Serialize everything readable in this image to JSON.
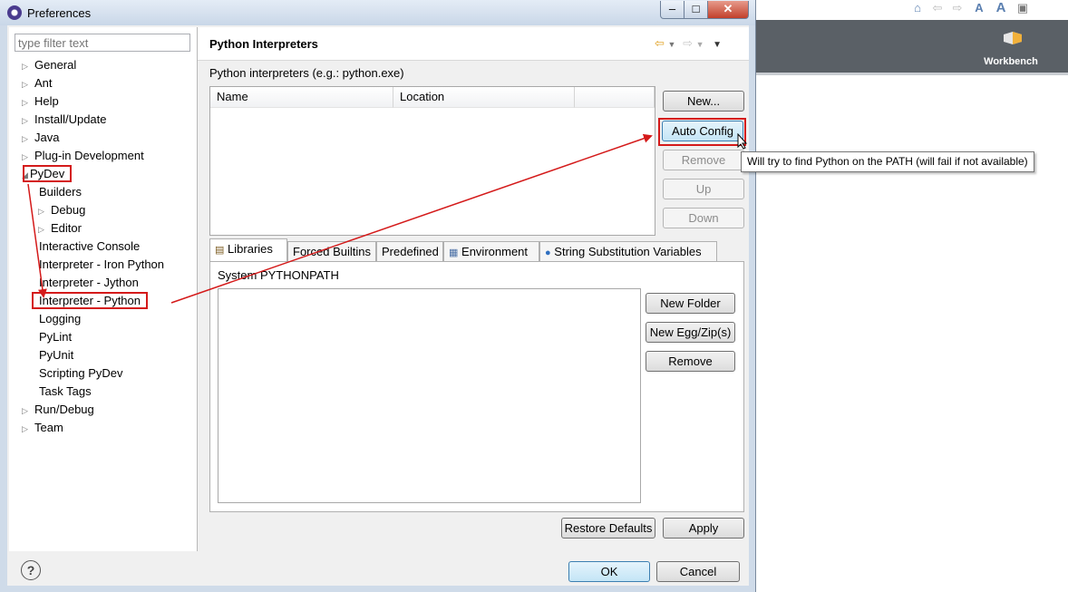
{
  "window": {
    "title": "Preferences"
  },
  "filter": {
    "placeholder": "type filter text"
  },
  "tree": [
    {
      "label": "General",
      "indent": 0,
      "expander": "collapsed"
    },
    {
      "label": "Ant",
      "indent": 0,
      "expander": "collapsed"
    },
    {
      "label": "Help",
      "indent": 0,
      "expander": "collapsed"
    },
    {
      "label": "Install/Update",
      "indent": 0,
      "expander": "collapsed"
    },
    {
      "label": "Java",
      "indent": 0,
      "expander": "collapsed"
    },
    {
      "label": "Plug-in Development",
      "indent": 0,
      "expander": "collapsed"
    },
    {
      "label": "PyDev",
      "indent": 0,
      "expander": "expanded",
      "highlight": true
    },
    {
      "label": "Builders",
      "indent": 1,
      "expander": "none"
    },
    {
      "label": "Debug",
      "indent": 1,
      "expander": "collapsed"
    },
    {
      "label": "Editor",
      "indent": 1,
      "expander": "collapsed"
    },
    {
      "label": "Interactive Console",
      "indent": 1,
      "expander": "none"
    },
    {
      "label": "Interpreter - Iron Python",
      "indent": 1,
      "expander": "none"
    },
    {
      "label": "Interpreter - Jython",
      "indent": 1,
      "expander": "none"
    },
    {
      "label": "Interpreter - Python",
      "indent": 1,
      "expander": "none",
      "highlight": true
    },
    {
      "label": "Logging",
      "indent": 1,
      "expander": "none"
    },
    {
      "label": "PyLint",
      "indent": 1,
      "expander": "none"
    },
    {
      "label": "PyUnit",
      "indent": 1,
      "expander": "none"
    },
    {
      "label": "Scripting PyDev",
      "indent": 1,
      "expander": "none"
    },
    {
      "label": "Task Tags",
      "indent": 1,
      "expander": "none"
    },
    {
      "label": "Run/Debug",
      "indent": 0,
      "expander": "collapsed"
    },
    {
      "label": "Team",
      "indent": 0,
      "expander": "collapsed"
    }
  ],
  "page": {
    "title": "Python Interpreters",
    "interpreters_label": "Python interpreters (e.g.: python.exe)",
    "columns": [
      "Name",
      "Location"
    ]
  },
  "side_buttons": {
    "new": "New...",
    "auto_config": "Auto Config",
    "remove": "Remove",
    "up": "Up",
    "down": "Down"
  },
  "tooltip": "Will try to find Python on the PATH (will fail if not available)",
  "tabs": [
    "Libraries",
    "Forced Builtins",
    "Predefined",
    "Environment",
    "String Substitution Variables"
  ],
  "libraries": {
    "label": "System PYTHONPATH",
    "new_folder": "New Folder",
    "new_egg": "New Egg/Zip(s)",
    "remove": "Remove"
  },
  "footer": {
    "restore_defaults": "Restore Defaults",
    "apply": "Apply",
    "ok": "OK",
    "cancel": "Cancel"
  },
  "workbench": {
    "label": "Workbench"
  },
  "colors": {
    "annotation": "#d41a1a",
    "header_bg": "#5a6066",
    "focus_blue": "#3c7fb1"
  }
}
